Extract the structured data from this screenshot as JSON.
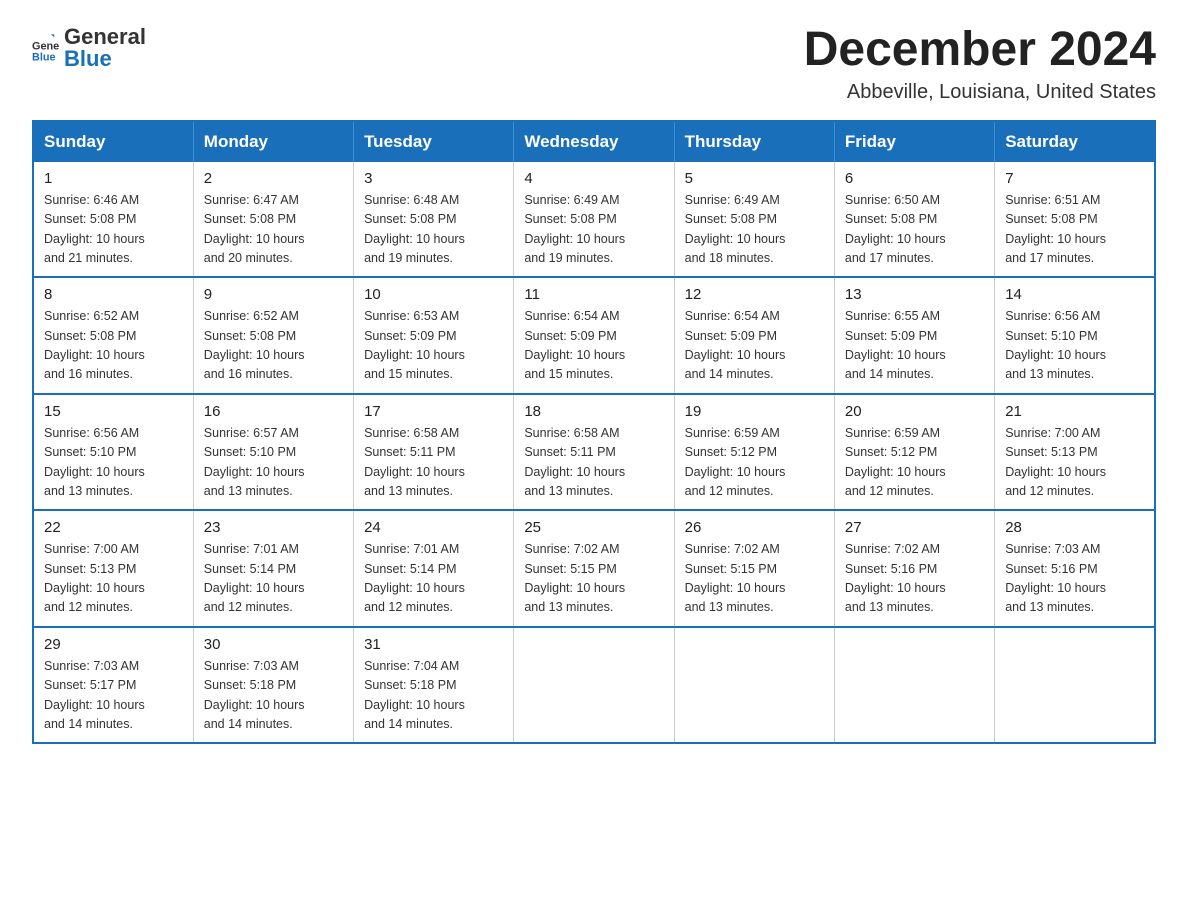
{
  "logo": {
    "general": "General",
    "blue": "Blue"
  },
  "title": "December 2024",
  "subtitle": "Abbeville, Louisiana, United States",
  "days_of_week": [
    "Sunday",
    "Monday",
    "Tuesday",
    "Wednesday",
    "Thursday",
    "Friday",
    "Saturday"
  ],
  "weeks": [
    [
      {
        "day": "1",
        "sunrise": "6:46 AM",
        "sunset": "5:08 PM",
        "daylight": "10 hours and 21 minutes."
      },
      {
        "day": "2",
        "sunrise": "6:47 AM",
        "sunset": "5:08 PM",
        "daylight": "10 hours and 20 minutes."
      },
      {
        "day": "3",
        "sunrise": "6:48 AM",
        "sunset": "5:08 PM",
        "daylight": "10 hours and 19 minutes."
      },
      {
        "day": "4",
        "sunrise": "6:49 AM",
        "sunset": "5:08 PM",
        "daylight": "10 hours and 19 minutes."
      },
      {
        "day": "5",
        "sunrise": "6:49 AM",
        "sunset": "5:08 PM",
        "daylight": "10 hours and 18 minutes."
      },
      {
        "day": "6",
        "sunrise": "6:50 AM",
        "sunset": "5:08 PM",
        "daylight": "10 hours and 17 minutes."
      },
      {
        "day": "7",
        "sunrise": "6:51 AM",
        "sunset": "5:08 PM",
        "daylight": "10 hours and 17 minutes."
      }
    ],
    [
      {
        "day": "8",
        "sunrise": "6:52 AM",
        "sunset": "5:08 PM",
        "daylight": "10 hours and 16 minutes."
      },
      {
        "day": "9",
        "sunrise": "6:52 AM",
        "sunset": "5:08 PM",
        "daylight": "10 hours and 16 minutes."
      },
      {
        "day": "10",
        "sunrise": "6:53 AM",
        "sunset": "5:09 PM",
        "daylight": "10 hours and 15 minutes."
      },
      {
        "day": "11",
        "sunrise": "6:54 AM",
        "sunset": "5:09 PM",
        "daylight": "10 hours and 15 minutes."
      },
      {
        "day": "12",
        "sunrise": "6:54 AM",
        "sunset": "5:09 PM",
        "daylight": "10 hours and 14 minutes."
      },
      {
        "day": "13",
        "sunrise": "6:55 AM",
        "sunset": "5:09 PM",
        "daylight": "10 hours and 14 minutes."
      },
      {
        "day": "14",
        "sunrise": "6:56 AM",
        "sunset": "5:10 PM",
        "daylight": "10 hours and 13 minutes."
      }
    ],
    [
      {
        "day": "15",
        "sunrise": "6:56 AM",
        "sunset": "5:10 PM",
        "daylight": "10 hours and 13 minutes."
      },
      {
        "day": "16",
        "sunrise": "6:57 AM",
        "sunset": "5:10 PM",
        "daylight": "10 hours and 13 minutes."
      },
      {
        "day": "17",
        "sunrise": "6:58 AM",
        "sunset": "5:11 PM",
        "daylight": "10 hours and 13 minutes."
      },
      {
        "day": "18",
        "sunrise": "6:58 AM",
        "sunset": "5:11 PM",
        "daylight": "10 hours and 13 minutes."
      },
      {
        "day": "19",
        "sunrise": "6:59 AM",
        "sunset": "5:12 PM",
        "daylight": "10 hours and 12 minutes."
      },
      {
        "day": "20",
        "sunrise": "6:59 AM",
        "sunset": "5:12 PM",
        "daylight": "10 hours and 12 minutes."
      },
      {
        "day": "21",
        "sunrise": "7:00 AM",
        "sunset": "5:13 PM",
        "daylight": "10 hours and 12 minutes."
      }
    ],
    [
      {
        "day": "22",
        "sunrise": "7:00 AM",
        "sunset": "5:13 PM",
        "daylight": "10 hours and 12 minutes."
      },
      {
        "day": "23",
        "sunrise": "7:01 AM",
        "sunset": "5:14 PM",
        "daylight": "10 hours and 12 minutes."
      },
      {
        "day": "24",
        "sunrise": "7:01 AM",
        "sunset": "5:14 PM",
        "daylight": "10 hours and 12 minutes."
      },
      {
        "day": "25",
        "sunrise": "7:02 AM",
        "sunset": "5:15 PM",
        "daylight": "10 hours and 13 minutes."
      },
      {
        "day": "26",
        "sunrise": "7:02 AM",
        "sunset": "5:15 PM",
        "daylight": "10 hours and 13 minutes."
      },
      {
        "day": "27",
        "sunrise": "7:02 AM",
        "sunset": "5:16 PM",
        "daylight": "10 hours and 13 minutes."
      },
      {
        "day": "28",
        "sunrise": "7:03 AM",
        "sunset": "5:16 PM",
        "daylight": "10 hours and 13 minutes."
      }
    ],
    [
      {
        "day": "29",
        "sunrise": "7:03 AM",
        "sunset": "5:17 PM",
        "daylight": "10 hours and 14 minutes."
      },
      {
        "day": "30",
        "sunrise": "7:03 AM",
        "sunset": "5:18 PM",
        "daylight": "10 hours and 14 minutes."
      },
      {
        "day": "31",
        "sunrise": "7:04 AM",
        "sunset": "5:18 PM",
        "daylight": "10 hours and 14 minutes."
      },
      null,
      null,
      null,
      null
    ]
  ],
  "sunrise_label": "Sunrise:",
  "sunset_label": "Sunset:",
  "daylight_label": "Daylight:",
  "accent_color": "#1a6fba"
}
